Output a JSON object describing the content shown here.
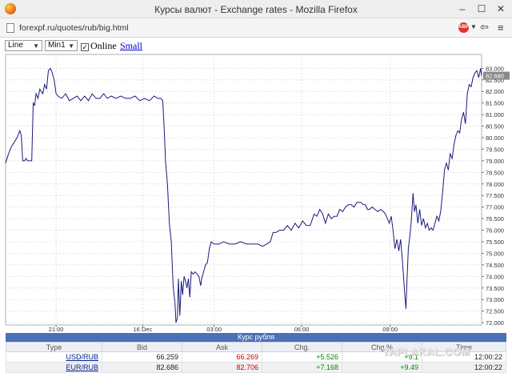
{
  "window": {
    "title": "Курсы валют - Exchange rates - Mozilla Firefox",
    "minimize": "–",
    "maximize": "☐",
    "close": "✕"
  },
  "browser": {
    "url": "forexpf.ru/quotes/rub/big.html",
    "adblock_label": "ABP",
    "icons": [
      "firefox-logo",
      "page-icon",
      "adblock-icon",
      "dropdown-icon",
      "back-arrow-icon",
      "menu-icon"
    ]
  },
  "controls": {
    "chart_type": "Line",
    "interval": "Min1",
    "online_checked": true,
    "online_label": "Online",
    "small_link": "Small"
  },
  "chart_data": {
    "type": "line",
    "title": "",
    "xlabel": "",
    "ylabel": "",
    "y_axis_position": "right",
    "ylim": [
      71.9,
      83.6
    ],
    "x_ticks": [
      {
        "t": 0.106,
        "label": "21:00"
      },
      {
        "t": 0.288,
        "label": "16 Dec"
      },
      {
        "t": 0.438,
        "label": "03:00"
      },
      {
        "t": 0.622,
        "label": "06:00"
      },
      {
        "t": 0.808,
        "label": "09:00"
      }
    ],
    "y_ticks": [
      72.0,
      72.5,
      73.0,
      73.5,
      74.0,
      74.5,
      75.0,
      75.5,
      76.0,
      76.5,
      77.0,
      77.5,
      78.0,
      78.5,
      79.0,
      79.5,
      80.0,
      80.5,
      81.0,
      81.5,
      82.0,
      82.5,
      83.0
    ],
    "y_tick_labels": [
      "72.000",
      "72.500",
      "73.000",
      "73.500",
      "74.000",
      "74.500",
      "75.000",
      "75.500",
      "76.000",
      "76.500",
      "77.000",
      "77.500",
      "78.000",
      "78.500",
      "79.000",
      "79.500",
      "80.000",
      "80.500",
      "81.000",
      "81.500",
      "82.000",
      "82.500",
      "83.000"
    ],
    "current_value_label": "82.680",
    "grid": true,
    "line_color": "#1a1a80",
    "series": [
      {
        "points": [
          [
            0.0,
            78.9
          ],
          [
            0.006,
            79.3
          ],
          [
            0.012,
            79.6
          ],
          [
            0.018,
            79.8
          ],
          [
            0.024,
            80.0
          ],
          [
            0.03,
            80.3
          ],
          [
            0.033,
            80.1
          ],
          [
            0.036,
            79.0
          ],
          [
            0.04,
            79.0
          ],
          [
            0.043,
            79.1
          ],
          [
            0.046,
            79.0
          ],
          [
            0.05,
            79.0
          ],
          [
            0.055,
            79.0
          ],
          [
            0.058,
            81.5
          ],
          [
            0.061,
            81.4
          ],
          [
            0.064,
            81.9
          ],
          [
            0.068,
            81.7
          ],
          [
            0.072,
            82.1
          ],
          [
            0.078,
            81.9
          ],
          [
            0.082,
            82.3
          ],
          [
            0.086,
            82.1
          ],
          [
            0.09,
            82.9
          ],
          [
            0.094,
            83.0
          ],
          [
            0.098,
            82.8
          ],
          [
            0.102,
            82.5
          ],
          [
            0.106,
            81.9
          ],
          [
            0.11,
            81.8
          ],
          [
            0.118,
            81.7
          ],
          [
            0.126,
            81.9
          ],
          [
            0.134,
            81.6
          ],
          [
            0.142,
            81.7
          ],
          [
            0.15,
            81.8
          ],
          [
            0.158,
            81.6
          ],
          [
            0.166,
            81.8
          ],
          [
            0.174,
            81.6
          ],
          [
            0.182,
            81.9
          ],
          [
            0.19,
            81.7
          ],
          [
            0.198,
            81.7
          ],
          [
            0.206,
            81.9
          ],
          [
            0.214,
            81.7
          ],
          [
            0.222,
            81.8
          ],
          [
            0.232,
            81.7
          ],
          [
            0.242,
            81.8
          ],
          [
            0.252,
            81.7
          ],
          [
            0.262,
            81.7
          ],
          [
            0.272,
            81.8
          ],
          [
            0.282,
            81.6
          ],
          [
            0.292,
            81.7
          ],
          [
            0.302,
            81.6
          ],
          [
            0.312,
            81.8
          ],
          [
            0.32,
            81.7
          ],
          [
            0.326,
            81.7
          ],
          [
            0.33,
            81.6
          ],
          [
            0.333,
            80.5
          ],
          [
            0.336,
            79.0
          ],
          [
            0.34,
            78.0
          ],
          [
            0.344,
            76.3
          ],
          [
            0.348,
            75.5
          ],
          [
            0.352,
            73.6
          ],
          [
            0.356,
            72.8
          ],
          [
            0.358,
            72.0
          ],
          [
            0.361,
            72.2
          ],
          [
            0.363,
            73.9
          ],
          [
            0.366,
            72.3
          ],
          [
            0.369,
            73.8
          ],
          [
            0.372,
            73.2
          ],
          [
            0.375,
            74.0
          ],
          [
            0.378,
            73.8
          ],
          [
            0.381,
            73.5
          ],
          [
            0.384,
            73.9
          ],
          [
            0.387,
            73.1
          ],
          [
            0.39,
            74.2
          ],
          [
            0.394,
            74.1
          ],
          [
            0.398,
            74.2
          ],
          [
            0.402,
            74.1
          ],
          [
            0.406,
            74.0
          ],
          [
            0.41,
            73.6
          ],
          [
            0.412,
            73.9
          ],
          [
            0.416,
            74.2
          ],
          [
            0.42,
            74.5
          ],
          [
            0.424,
            74.6
          ],
          [
            0.428,
            75.2
          ],
          [
            0.432,
            75.5
          ],
          [
            0.438,
            75.4
          ],
          [
            0.448,
            75.4
          ],
          [
            0.458,
            75.5
          ],
          [
            0.47,
            75.4
          ],
          [
            0.482,
            75.4
          ],
          [
            0.494,
            75.5
          ],
          [
            0.506,
            75.4
          ],
          [
            0.518,
            75.4
          ],
          [
            0.53,
            75.4
          ],
          [
            0.54,
            75.3
          ],
          [
            0.548,
            75.4
          ],
          [
            0.556,
            75.5
          ],
          [
            0.562,
            75.9
          ],
          [
            0.568,
            75.9
          ],
          [
            0.576,
            76.0
          ],
          [
            0.584,
            76.0
          ],
          [
            0.592,
            76.2
          ],
          [
            0.6,
            76.0
          ],
          [
            0.608,
            76.3
          ],
          [
            0.616,
            76.1
          ],
          [
            0.624,
            76.4
          ],
          [
            0.632,
            76.2
          ],
          [
            0.64,
            76.2
          ],
          [
            0.648,
            76.7
          ],
          [
            0.654,
            76.6
          ],
          [
            0.66,
            76.9
          ],
          [
            0.666,
            76.7
          ],
          [
            0.672,
            76.3
          ],
          [
            0.678,
            76.7
          ],
          [
            0.684,
            76.5
          ],
          [
            0.69,
            76.6
          ],
          [
            0.696,
            76.6
          ],
          [
            0.702,
            76.9
          ],
          [
            0.708,
            76.8
          ],
          [
            0.714,
            77.0
          ],
          [
            0.72,
            77.1
          ],
          [
            0.726,
            77.1
          ],
          [
            0.732,
            77.0
          ],
          [
            0.738,
            77.2
          ],
          [
            0.746,
            77.2
          ],
          [
            0.752,
            77.1
          ],
          [
            0.756,
            77.1
          ],
          [
            0.76,
            76.9
          ],
          [
            0.764,
            76.9
          ],
          [
            0.77,
            77.0
          ],
          [
            0.776,
            76.9
          ],
          [
            0.782,
            76.8
          ],
          [
            0.788,
            76.9
          ],
          [
            0.794,
            76.8
          ],
          [
            0.798,
            76.7
          ],
          [
            0.802,
            76.5
          ],
          [
            0.806,
            76.3
          ],
          [
            0.81,
            76.6
          ],
          [
            0.814,
            76.0
          ],
          [
            0.818,
            75.2
          ],
          [
            0.822,
            75.6
          ],
          [
            0.826,
            75.1
          ],
          [
            0.83,
            75.6
          ],
          [
            0.834,
            74.6
          ],
          [
            0.838,
            73.4
          ],
          [
            0.841,
            72.6
          ],
          [
            0.844,
            74.2
          ],
          [
            0.846,
            75.2
          ],
          [
            0.849,
            75.7
          ],
          [
            0.852,
            76.3
          ],
          [
            0.856,
            77.6
          ],
          [
            0.859,
            76.8
          ],
          [
            0.862,
            77.1
          ],
          [
            0.866,
            76.3
          ],
          [
            0.87,
            76.9
          ],
          [
            0.874,
            76.2
          ],
          [
            0.878,
            76.5
          ],
          [
            0.882,
            76.1
          ],
          [
            0.886,
            76.3
          ],
          [
            0.89,
            76.0
          ],
          [
            0.894,
            76.1
          ],
          [
            0.898,
            76.0
          ],
          [
            0.902,
            76.3
          ],
          [
            0.906,
            76.6
          ],
          [
            0.91,
            76.4
          ],
          [
            0.914,
            76.8
          ],
          [
            0.918,
            77.6
          ],
          [
            0.922,
            78.6
          ],
          [
            0.926,
            78.9
          ],
          [
            0.93,
            78.6
          ],
          [
            0.934,
            79.3
          ],
          [
            0.938,
            79.1
          ],
          [
            0.942,
            79.7
          ],
          [
            0.946,
            80.1
          ],
          [
            0.95,
            80.3
          ],
          [
            0.954,
            80.2
          ],
          [
            0.958,
            80.8
          ],
          [
            0.962,
            81.1
          ],
          [
            0.966,
            80.6
          ],
          [
            0.97,
            81.9
          ],
          [
            0.974,
            82.3
          ],
          [
            0.978,
            82.2
          ],
          [
            0.982,
            82.6
          ],
          [
            0.986,
            82.8
          ],
          [
            0.99,
            82.9
          ],
          [
            0.994,
            82.6
          ],
          [
            0.998,
            83.0
          ],
          [
            1.0,
            82.68
          ]
        ]
      }
    ]
  },
  "rates": {
    "caption": "Курс рубля",
    "headers": [
      "Type",
      "Bid",
      "Ask",
      "Chg.",
      "Chg.%",
      "Time"
    ],
    "rows": [
      {
        "pair": "USD/RUB",
        "bid": "66.259",
        "ask": "66.269",
        "chg": "+5.526",
        "chg_pct": "+9.1",
        "time": "12:00:22"
      },
      {
        "pair": "EUR/RUB",
        "bid": "82.686",
        "ask": "82.706",
        "chg": "+7.168",
        "chg_pct": "+9.49",
        "time": "12:00:22"
      }
    ]
  },
  "watermark": "YAPLAKAL.COM",
  "colors": {
    "caption_bg": "#4a70b8",
    "ask_red": "#cc0000",
    "chg_green": "#008800",
    "link_blue": "#0000cc"
  }
}
